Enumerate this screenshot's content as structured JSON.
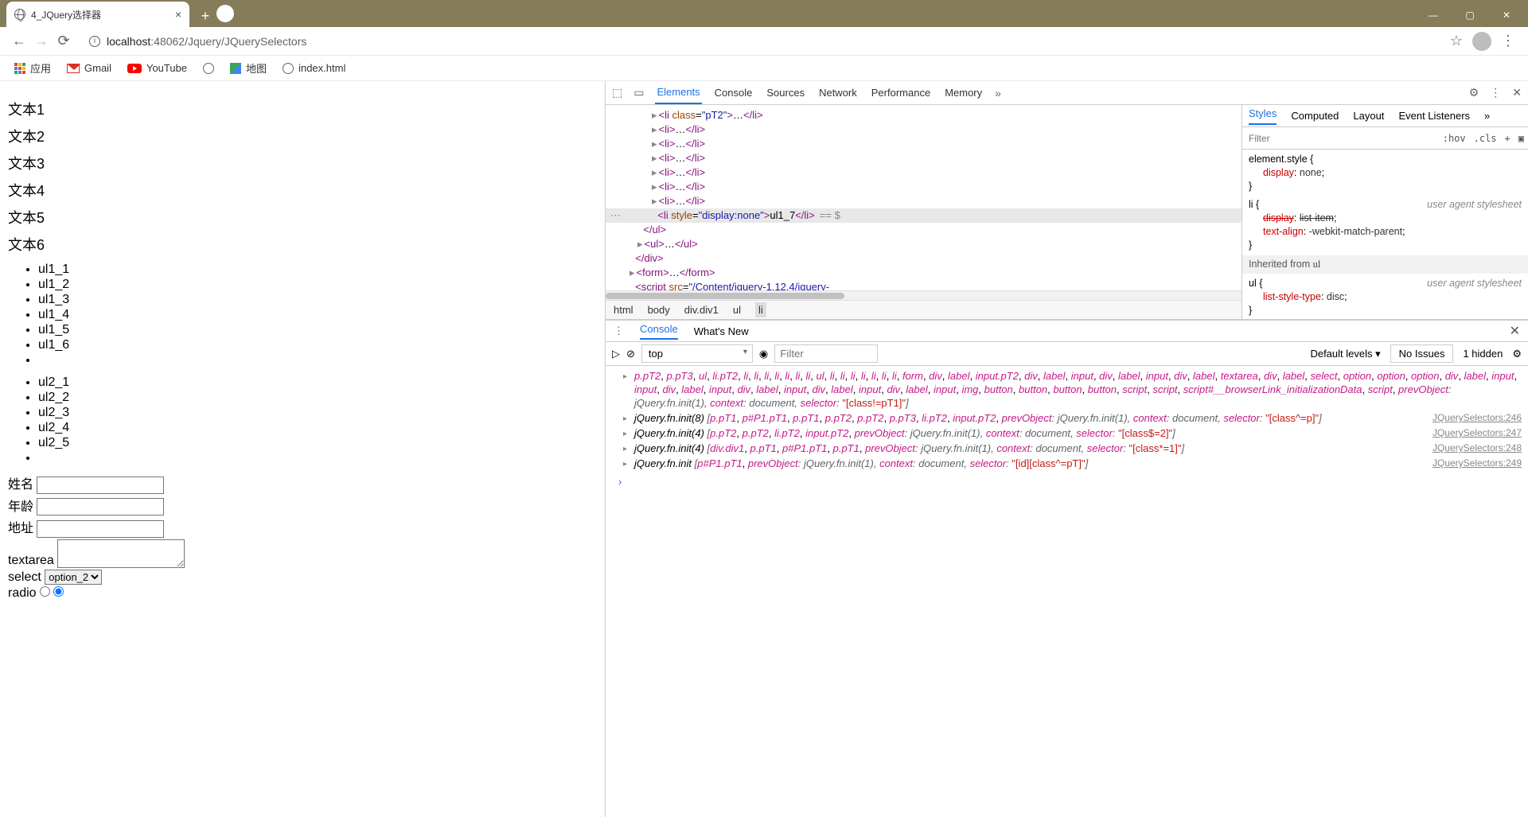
{
  "browser": {
    "tab_title": "4_JQuery选择器",
    "url_host": "localhost",
    "url_port": ":48062",
    "url_path": "/Jquery/JQuerySelectors",
    "bookmarks": {
      "apps": "应用",
      "gmail": "Gmail",
      "youtube": "YouTube",
      "maps": "地图",
      "index": "index.html"
    }
  },
  "page": {
    "texts": [
      "文本1",
      "文本2",
      "文本3",
      "文本4",
      "文本5",
      "文本6"
    ],
    "ul1": [
      "ul1_1",
      "ul1_2",
      "ul1_3",
      "ul1_4",
      "ul1_5",
      "ul1_6"
    ],
    "ul2": [
      "ul2_1",
      "ul2_2",
      "ul2_3",
      "ul2_4",
      "ul2_5"
    ],
    "form": {
      "name_label": "姓名",
      "age_label": "年龄",
      "addr_label": "地址",
      "textarea_label": "textarea",
      "select_label": "select",
      "select_value": "option_2",
      "radio_label": "radio"
    }
  },
  "devtools": {
    "tabs": [
      "Elements",
      "Console",
      "Sources",
      "Network",
      "Performance",
      "Memory"
    ],
    "active_tab": "Elements",
    "breadcrumb": [
      "html",
      "body",
      "div.div1",
      "ul",
      "li"
    ],
    "styles_tabs": [
      "Styles",
      "Computed",
      "Layout",
      "Event Listeners"
    ],
    "filter_placeholder": "Filter",
    "hov": ":hov",
    "cls": ".cls",
    "rules": {
      "element_style": {
        "selector": "element.style {",
        "display": "display",
        "display_val": "none"
      },
      "li": {
        "selector": "li {",
        "src": "user agent stylesheet",
        "display_prop": "display",
        "display_val": "list-item",
        "textalign_prop": "text-align",
        "textalign_val": "-webkit-match-parent"
      },
      "inherited_from": "Inherited from",
      "inherited_sel": "ul",
      "ul": {
        "selector": "ul {",
        "src": "user agent stylesheet",
        "liststyle_prop": "list-style-type",
        "liststyle_val": "disc"
      }
    },
    "elements_source": {
      "li_pt2_open": "<li class=\"pT2\">",
      "li_open": "<li>",
      "li_close": "</li>",
      "selected_open": "<li style=\"display:none\">",
      "selected_text": "ul1_7",
      "selected_hint": "== $",
      "ul_close": "</ul>",
      "ul_open": "<ul>",
      "div_close": "</div>",
      "form_open": "<form>",
      "form_close": "</form>",
      "script_tag": "<script src=\"/Content/jquery-1.12.4/jquery-"
    },
    "console": {
      "tabs": [
        "Console",
        "What's New"
      ],
      "context": "top",
      "filter_placeholder": "Filter",
      "levels": "Default levels",
      "issues": "No Issues",
      "hidden": "1 hidden",
      "sources": {
        "s246": "JQuerySelectors:246",
        "s247": "JQuerySelectors:247",
        "s248": "JQuerySelectors:248",
        "s249": "JQuerySelectors:249"
      },
      "log0": "p.pT2, p.pT3, ul, li.pT2, li, li, li, li, li, li, li, ul, li, li, li, li, li, li, li, form, div, label, input.pT2, div, label, input, div, label, input, div, label, textarea, div, label, select, option, option, option, div, label, input, input, div, label, input, div, label, input, div, label, input, div, label, input, div, label, input, div, label, input, img, button, button, button, button, script, script, script#__browserLink_initializationData, script, prevObject: jQuery.fn.init(1), context: document, selector: \"[class!=pT1]\"]",
      "log1": "jQuery.fn.init(8) [p.pT1, p#P1.pT1, p.pT1, p.pT2, p.pT2, p.pT3, li.pT2, input.pT2, prevObject: jQuery.fn.init(1), context: document, selector: \"[class^=p]\"]",
      "log2": "jQuery.fn.init(4) [p.pT2, p.pT2, li.pT2, input.pT2, prevObject: jQuery.fn.init(1), context: document, selector: \"[class$=2]\"]",
      "log3": "jQuery.fn.init(4) [div.div1, p.pT1, p#P1.pT1, p.pT1, prevObject: jQuery.fn.init(1), context: document, selector: \"[class*=1]\"]",
      "log4": "jQuery.fn.init [p#P1.pT1, prevObject: jQuery.fn.init(1), context: document, selector: \"[id][class^=pT]\"]"
    }
  }
}
